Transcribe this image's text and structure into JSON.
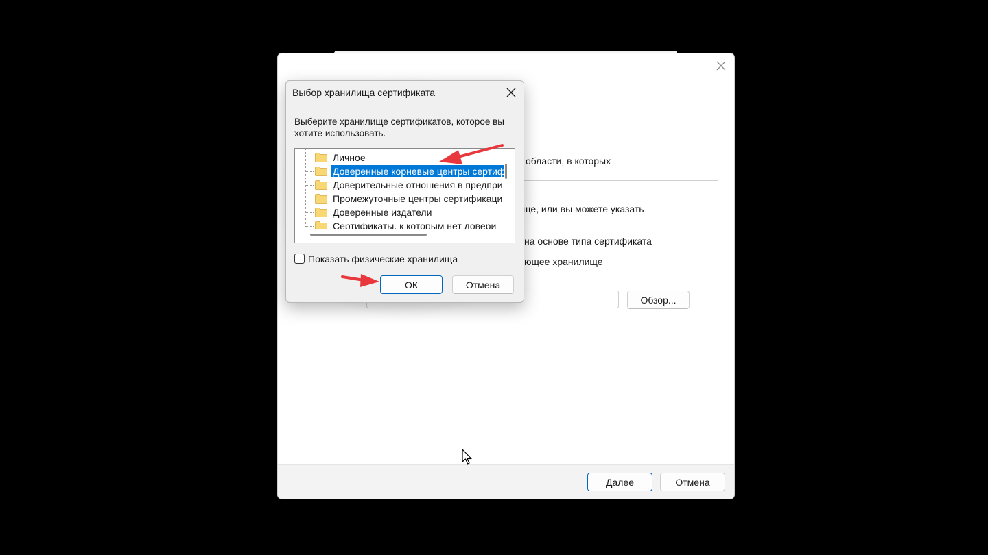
{
  "wizard": {
    "text_line1": "области, в которых",
    "text_line2": "ще, или вы можете указать",
    "radio_auto": "на основе типа сертификата",
    "radio_manual": "ющее хранилище",
    "browse_label": "Обзор...",
    "next_label": "Далее",
    "cancel_label": "Отмена"
  },
  "dialog": {
    "title": "Выбор хранилища сертификата",
    "description": "Выберите хранилище сертификатов, которое вы хотите использовать.",
    "stores": [
      {
        "label": "Личное"
      },
      {
        "label": "Доверенные корневые центры сертиф",
        "selected": true
      },
      {
        "label": "Доверительные отношения в предпри"
      },
      {
        "label": "Промежуточные центры сертификаци"
      },
      {
        "label": "Доверенные издатели"
      },
      {
        "label": "Сертификаты, к которым нет довери"
      }
    ],
    "show_physical_label": "Показать физические хранилища",
    "show_physical_checked": false,
    "ok_label": "ОК",
    "cancel_label": "Отмена"
  },
  "colors": {
    "selection": "#0078d7",
    "primary_border": "#0067c0",
    "annotation_arrow": "#e8383d"
  }
}
